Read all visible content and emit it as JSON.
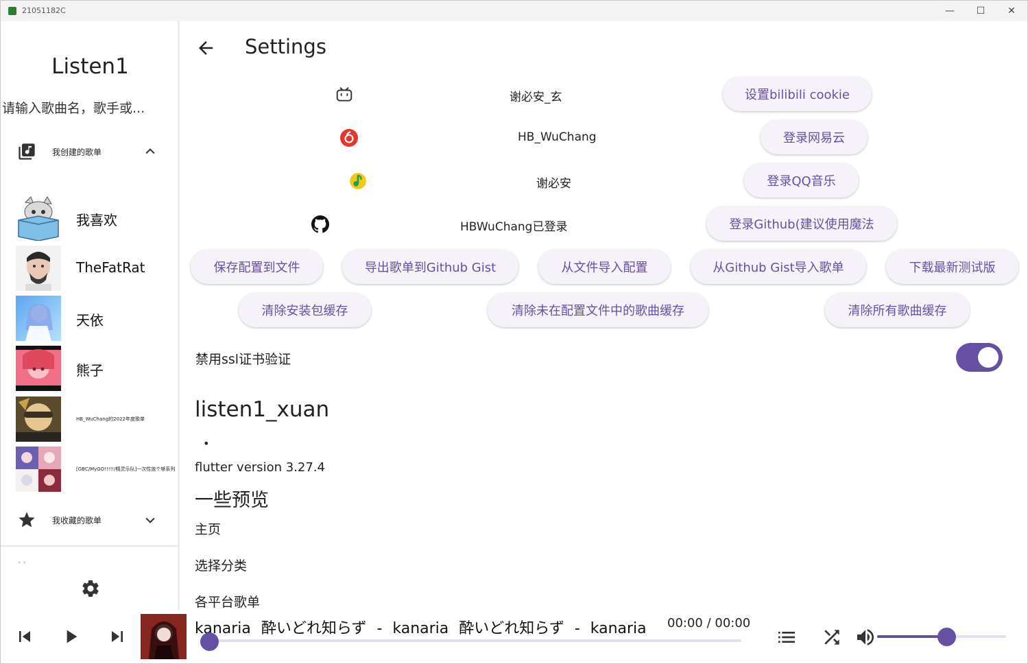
{
  "window": {
    "title": "21051182C",
    "minimize_glyph": "—",
    "maximize_glyph": "☐",
    "close_glyph": "✕"
  },
  "sidebar": {
    "logo": "Listen1",
    "search_placeholder": "请输入歌曲名，歌手或...",
    "my_playlists_label": "我创建的歌单",
    "playlists": [
      {
        "name": "我喜欢"
      },
      {
        "name": "TheFatRat"
      },
      {
        "name": "天依"
      },
      {
        "name": "熊子"
      },
      {
        "name": "HB_WuChang的2022年度歌单"
      },
      {
        "name": "[GBC/MyGO!!!!!/精灵乐队]一次性放个够系列"
      }
    ],
    "favorite_playlists_label": "我收藏的歌单",
    "collapsed_mark": "˅ ˅",
    "icons": {
      "my_playlists": "library-music-icon",
      "favorites": "star-icon",
      "settings": "gear-icon"
    }
  },
  "settings": {
    "title": "Settings",
    "accounts": [
      {
        "icon": "bilibili-icon",
        "name": "谢必安_玄",
        "button": "设置bilibili cookie"
      },
      {
        "icon": "netease-icon",
        "name": "HB_WuChang",
        "button": "登录网易云"
      },
      {
        "icon": "qqmusic-icon",
        "name": "谢必安",
        "button": "登录QQ音乐"
      },
      {
        "icon": "github-icon",
        "name": "HBWuChang已登录",
        "button": "登录Github(建议使用魔法"
      }
    ],
    "actions_row1": [
      "保存配置到文件",
      "导出歌单到Github Gist",
      "从文件导入配置",
      "从Github Gist导入歌单",
      "下载最新测试版"
    ],
    "actions_row2": [
      "清除安装包缓存",
      "清除未在配置文件中的歌曲缓存",
      "清除所有歌曲缓存"
    ],
    "ssl_label": "禁用ssl证书验证",
    "ssl_enabled": true,
    "app_name": "listen1_xuan",
    "bullet": "•",
    "flutter_version": "flutter version 3.27.4",
    "preview_heading": "一些预览",
    "preview_items": [
      "主页",
      "选择分类",
      "各平台歌单"
    ]
  },
  "player": {
    "now_playing": "kanaria    酔いどれ知らず  -  kanaria    酔いどれ知らず  -  kanaria",
    "time": "00:00 / 00:00",
    "progress": 0.0,
    "volume": 0.54,
    "accent": "#6650a4",
    "icons": [
      "skip-previous-icon",
      "play-icon",
      "skip-next-icon",
      "playlist-icon",
      "shuffle-icon",
      "volume-icon"
    ]
  }
}
